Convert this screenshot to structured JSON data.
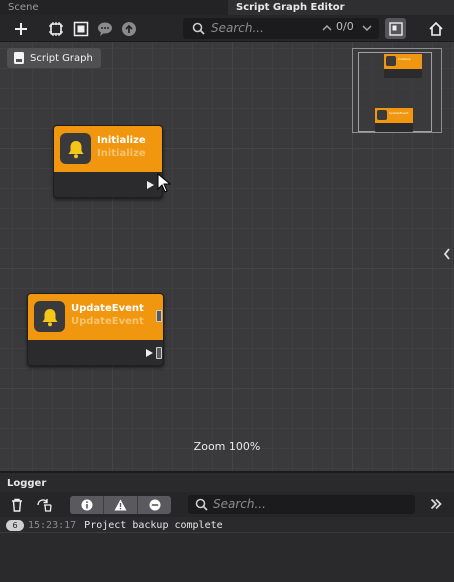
{
  "tabs": [
    {
      "label": "Scene",
      "active": false
    },
    {
      "label": "Script Graph Editor",
      "active": true
    }
  ],
  "toolbar": {
    "buttons": [
      "add-icon",
      "graph-settings-icon",
      "fit-view-icon",
      "comment-icon",
      "upload-icon"
    ],
    "search": {
      "placeholder": "Search...",
      "count": "0/0"
    }
  },
  "canvas": {
    "breadcrumb": "Script Graph",
    "nodes": [
      {
        "title": "Initialize",
        "subtitle": "Initialize",
        "icon": "bell-icon"
      },
      {
        "title": "UpdateEvent",
        "subtitle": "UpdateEvent",
        "icon": "bell-icon"
      }
    ],
    "zoom": "Zoom 100%",
    "minimap": {
      "nodes": [
        "Initialize",
        "UpdateEvent"
      ]
    }
  },
  "logger": {
    "title": "Logger",
    "search": {
      "placeholder": "Search..."
    },
    "filters": [
      "info-icon",
      "warning-icon",
      "error-icon"
    ],
    "entries": [
      {
        "count": "6",
        "time": "15:23:17",
        "message": "Project backup complete"
      }
    ]
  },
  "colors": {
    "node_header": "#f0960f",
    "canvas": "#3a3a3c",
    "panel": "#262628"
  }
}
